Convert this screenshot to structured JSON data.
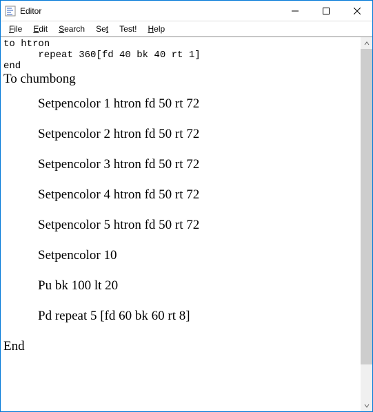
{
  "window": {
    "title": "Editor"
  },
  "menu": {
    "file": "File",
    "edit": "Edit",
    "search": "Search",
    "set": "Set",
    "test": "Test!",
    "help": "Help"
  },
  "code": {
    "mono_lines": "to htron\n      repeat 360[fd 40 bk 40 rt 1]\nend",
    "def_header": "To chumbong",
    "stmts": [
      "Setpencolor 1 htron fd 50 rt 72",
      "Setpencolor 2 htron fd 50 rt 72",
      "Setpencolor 3 htron fd 50 rt 72",
      "Setpencolor 4 htron fd 50 rt 72",
      "Setpencolor 5 htron fd 50 rt 72",
      "Setpencolor 10",
      "Pu bk 100 lt 20",
      "Pd repeat 5 [fd 60 bk 60 rt 8]"
    ],
    "end": "End"
  }
}
